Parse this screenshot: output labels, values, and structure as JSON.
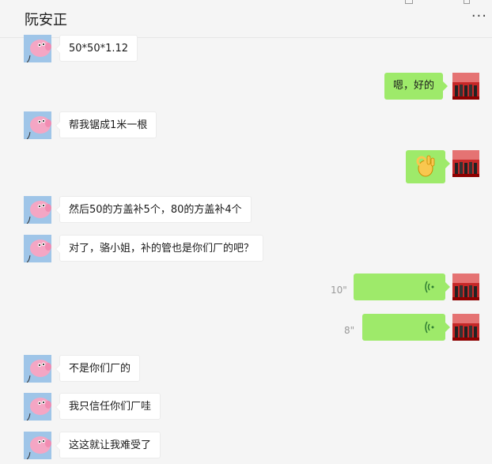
{
  "header": {
    "title": "阮安正",
    "more_label": "···"
  },
  "messages": [
    {
      "side": "in",
      "text": "50*50*1.12"
    },
    {
      "side": "out",
      "text": "嗯，好的"
    },
    {
      "side": "in",
      "text": "帮我锯成1米一根"
    },
    {
      "side": "out",
      "type": "emoji",
      "icon": "ok-hand-icon"
    },
    {
      "side": "in",
      "text": "然后50的方盖补5个，80的方盖补4个"
    },
    {
      "side": "in",
      "text": "对了，骆小姐，补的管也是你们厂的吧？"
    },
    {
      "side": "out",
      "type": "voice",
      "duration": "10\""
    },
    {
      "side": "out",
      "type": "voice",
      "duration": "8\""
    },
    {
      "side": "in",
      "text": "不是你们厂的"
    },
    {
      "side": "in",
      "text": "我只信任你们厂哇"
    },
    {
      "side": "in",
      "text": "这这就让我难受了"
    }
  ],
  "colors": {
    "background": "#f5f5f5",
    "outgoing_bubble": "#9eea6a",
    "incoming_bubble": "#ffffff",
    "duration_text": "#999999"
  }
}
